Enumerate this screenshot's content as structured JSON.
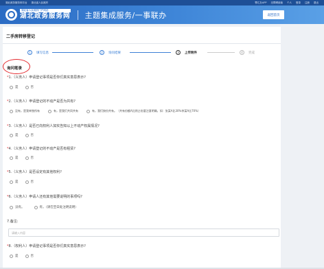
{
  "topbar": {
    "left": [
      "湖北政务服务网平台",
      "湖北省人民政府"
    ],
    "right": [
      "鄂汇办APP",
      "无障碍阅读",
      "个人",
      "登录",
      "注册",
      "退出"
    ]
  },
  "header": {
    "logo_sub": "湖北省人民政府门户网站",
    "logo_main": "湖北政务服务网",
    "title": "主题集成服务/一事联办",
    "button": "返回首页"
  },
  "panel": {
    "title": "二手房转移登记"
  },
  "steps": [
    {
      "num": "1",
      "label": "填写信息",
      "state": "done"
    },
    {
      "num": "2",
      "label": "询问结果",
      "state": "done"
    },
    {
      "num": "3",
      "label": "上传附件",
      "state": "current"
    },
    {
      "num": "4",
      "label": "完成",
      "state": "todo"
    }
  ],
  "section_label": "询问笔录",
  "questions": [
    {
      "num": "1.",
      "text": "（义务人）申请登记事项是否你们真实意思表示?",
      "required": true,
      "options": [
        "是",
        "否"
      ]
    },
    {
      "num": "2.",
      "text": "（义务人）申请登记的不动产是否为共有?",
      "required": true,
      "options": [
        "没有，是我单独所有",
        "有，是我们共同共有",
        "有，我们按份共有。（共有份额A比例占份要注意明确，如：张某A比30%李某A比70%）"
      ]
    },
    {
      "num": "3.",
      "text": "（义务人）是否已向权利人如实告知以上不动产权属情况?",
      "required": true,
      "options": [
        "是",
        "否"
      ]
    },
    {
      "num": "4.",
      "text": "（义务人）申请登记的不动产是否有租赁?",
      "required": true,
      "options": [
        "是",
        "否"
      ]
    },
    {
      "num": "5.",
      "text": "（义务人）是否设定有其他权利?",
      "required": true,
      "options": [
        "是",
        "否"
      ]
    },
    {
      "num": "6.",
      "text": "（义务人）申请人还有其他需要说明的事项吗?",
      "required": true,
      "options": [
        "没有。",
        "有，（请在空白处注明说明）"
      ]
    },
    {
      "num": "7.",
      "text": "备注:",
      "required": false,
      "options": []
    },
    {
      "num": "8.",
      "text": "（权利人）申请登记事项是否你们真实意思表示?",
      "required": true,
      "options": [
        "是",
        "否"
      ]
    }
  ],
  "remarks_placeholder": "请输入内容"
}
